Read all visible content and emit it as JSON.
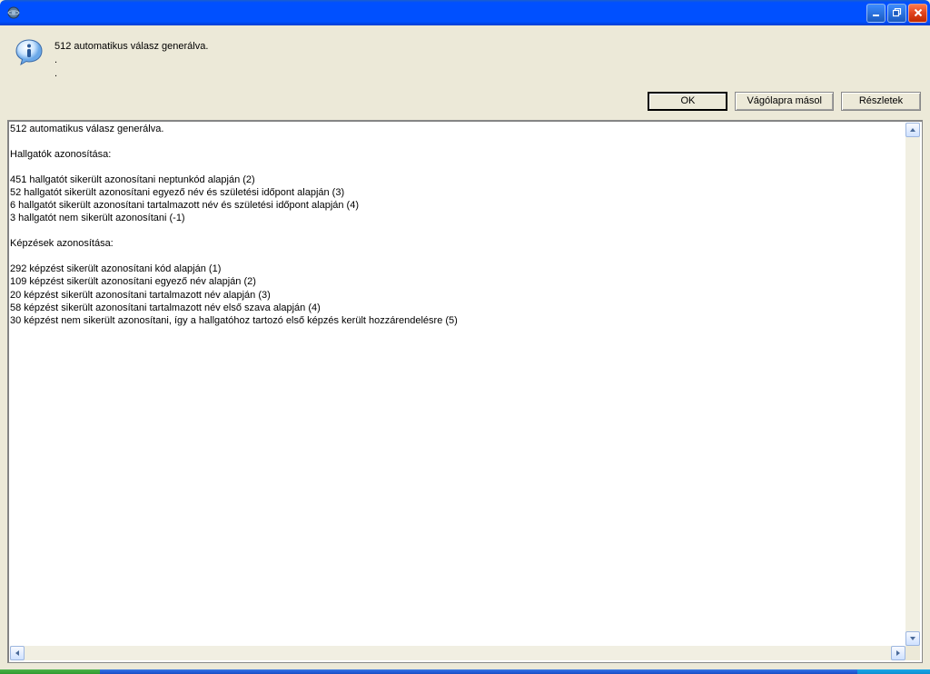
{
  "window": {
    "title": ""
  },
  "info": {
    "main_message": "512 automatikus válasz generálva.",
    "sub1": ".",
    "sub2": "."
  },
  "buttons": {
    "ok": "OK",
    "clipboard": "Vágólapra másol",
    "details": "Részletek"
  },
  "details_text": "512 automatikus válasz generálva.\n\nHallgatók azonosítása:\n\n451 hallgatót sikerült azonosítani neptunkód alapján (2)\n52 hallgatót sikerült azonosítani egyező név és születési időpont alapján (3)\n6 hallgatót sikerült azonosítani tartalmazott név és születési időpont alapján (4)\n3 hallgatót nem sikerült azonosítani (-1)\n\nKépzések azonosítása:\n\n292 képzést sikerült azonosítani kód alapján (1)\n109 képzést sikerült azonosítani egyező név alapján (2)\n20 képzést sikerült azonosítani tartalmazott név alapján (3)\n58 képzést sikerült azonosítani tartalmazott név első szava alapján (4)\n30 képzést nem sikerült azonosítani, így a hallgatóhoz tartozó első képzés került hozzárendelésre (5)"
}
